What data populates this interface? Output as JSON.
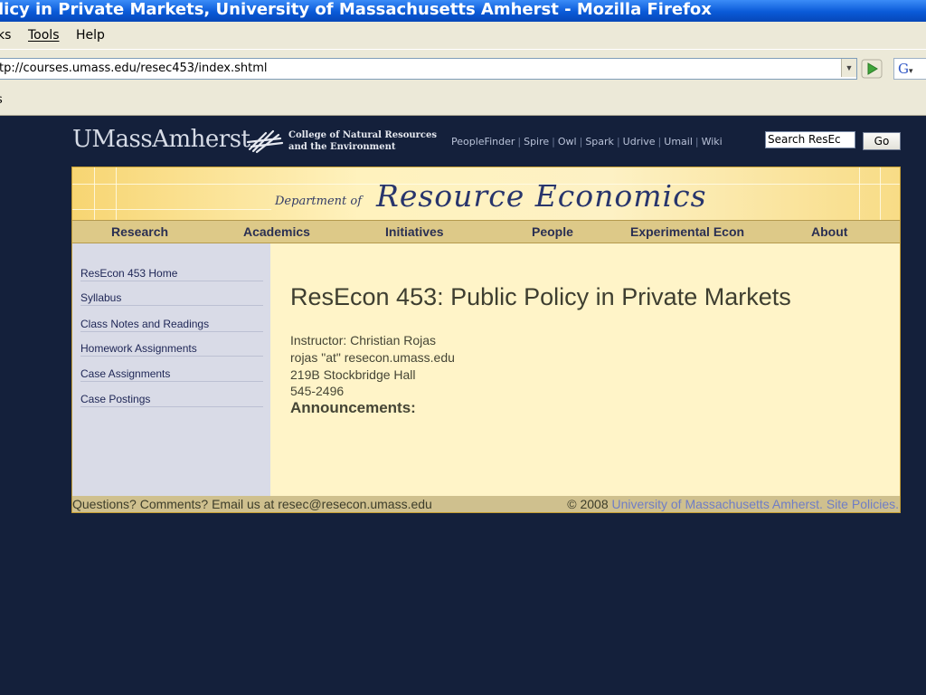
{
  "window": {
    "title": "licy in Private Markets, University of Massachusetts Amherst - Mozilla Firefox"
  },
  "menu": {
    "items": [
      "ks",
      "Tools",
      "Help"
    ]
  },
  "navigation": {
    "url": "tp://courses.umass.edu/resec453/index.shtml",
    "search_engine_glyph": "G"
  },
  "bookmarks": {
    "visible_fragment": "s"
  },
  "header": {
    "logo": "UMassAmherst",
    "college_line1": "College of Natural Resources",
    "college_line2": "and the Environment",
    "links": [
      "PeopleFinder",
      "Spire",
      "Owl",
      "Spark",
      "Udrive",
      "Umail",
      "Wiki"
    ],
    "search_value": "Search ResEc",
    "go_label": "Go"
  },
  "banner": {
    "dept_prefix": "Department of",
    "dept_name": "Resource Economics"
  },
  "nav_tabs": [
    "Research",
    "Academics",
    "Initiatives",
    "People",
    "Experimental Econ",
    "About"
  ],
  "sidebar": {
    "items": [
      "ResEcon 453 Home",
      "Syllabus",
      "Class Notes and Readings",
      "Homework Assignments",
      "Case Assignments",
      "Case Postings"
    ]
  },
  "main": {
    "title": "ResEcon 453: Public Policy in Private Markets",
    "instructor": "Instructor: Christian Rojas",
    "email": "rojas \"at\" resecon.umass.edu",
    "office": "219B Stockbridge Hall",
    "phone": "545-2496",
    "announcements": "Announcements:"
  },
  "footer": {
    "contact": "Questions? Comments? Email us at resec@resecon.umass.edu",
    "copyright": "© 2008 ",
    "university_link": "University of Massachusetts Amherst.",
    "policies_link": "Site Policies."
  },
  "colors": {
    "page_background": "#14203b",
    "banner_text": "#28356c",
    "sidebar_background": "#d9dbe7",
    "main_background": "#fff4c8"
  }
}
